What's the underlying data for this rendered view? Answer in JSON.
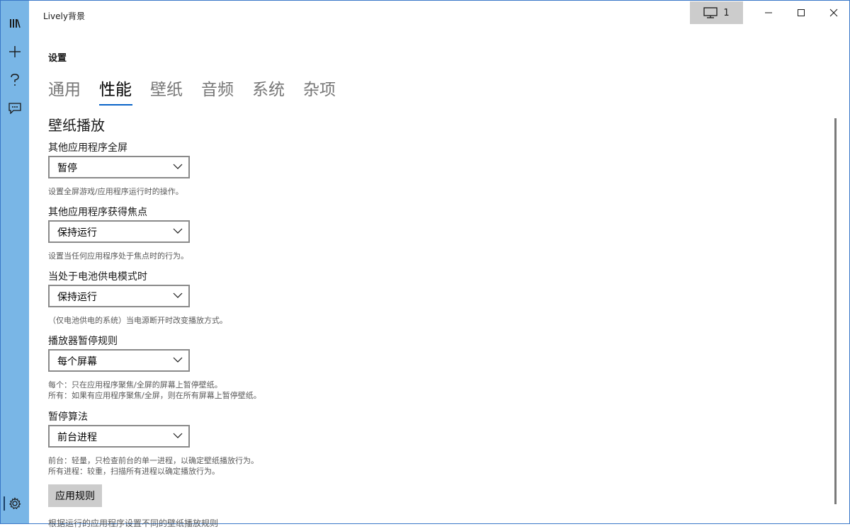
{
  "app": {
    "title": "Lively背景"
  },
  "rail": {
    "items": [
      {
        "icon": "library-icon"
      },
      {
        "icon": "add-icon"
      },
      {
        "icon": "help-icon"
      },
      {
        "icon": "feedback-icon"
      }
    ],
    "settings_icon": "gear-icon"
  },
  "titlebar": {
    "monitor_count": "1"
  },
  "page": {
    "title": "设置"
  },
  "tabs": [
    {
      "label": "通用",
      "selected": false
    },
    {
      "label": "性能",
      "selected": true
    },
    {
      "label": "壁纸",
      "selected": false
    },
    {
      "label": "音频",
      "selected": false
    },
    {
      "label": "系统",
      "selected": false
    },
    {
      "label": "杂项",
      "selected": false
    }
  ],
  "section": {
    "title": "壁纸播放"
  },
  "settings": [
    {
      "label": "其他应用程序全屏",
      "value": "暂停",
      "desc1": "设置全屏游戏/应用程序运行时的操作。",
      "desc2": ""
    },
    {
      "label": "其他应用程序获得焦点",
      "value": "保持运行",
      "desc1": "设置当任何应用程序处于焦点时的行为。",
      "desc2": ""
    },
    {
      "label": "当处于电池供电模式时",
      "value": "保持运行",
      "desc1": "（仅电池供电的系统）当电源断开时改变播放方式。",
      "desc2": ""
    },
    {
      "label": "播放器暂停规则",
      "value": "每个屏幕",
      "desc1": "每个：只在应用程序聚焦/全屏的屏幕上暂停壁纸。",
      "desc2": "所有：如果有应用程序聚焦/全屏，则在所有屏幕上暂停壁纸。"
    },
    {
      "label": "暂停算法",
      "value": "前台进程",
      "desc1": "前台：轻量，只检查前台的单一进程，以确定壁纸播放行为。",
      "desc2": "所有进程：较重，扫描所有进程以确定播放行为。"
    }
  ],
  "apply_button": {
    "label": "应用规则"
  },
  "footer": {
    "partial_text": "根据运行的应用程序设置不同的壁纸播放规则"
  }
}
